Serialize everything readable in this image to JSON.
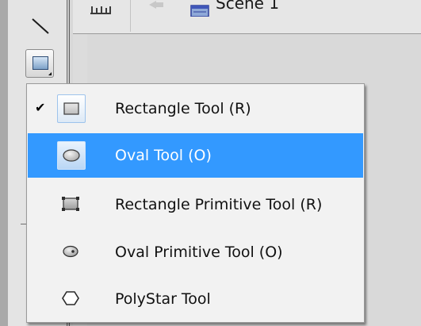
{
  "editbar": {
    "scene_label": "Scene 1"
  },
  "toolbar": {
    "tools": [
      {
        "name": "line-tool",
        "icon": "line-icon"
      },
      {
        "name": "rectangle-tool",
        "icon": "rectangle-icon",
        "active": true
      }
    ]
  },
  "menu": {
    "items": [
      {
        "label": "Rectangle Tool (R)",
        "icon": "rectangle-icon",
        "checked": true,
        "highlighted": false
      },
      {
        "label": "Oval Tool (O)",
        "icon": "oval-icon",
        "checked": false,
        "highlighted": true
      },
      {
        "label": "Rectangle Primitive Tool (R)",
        "icon": "rectangle-primitive-icon",
        "checked": false,
        "highlighted": false
      },
      {
        "label": "Oval Primitive Tool (O)",
        "icon": "oval-primitive-icon",
        "checked": false,
        "highlighted": false
      },
      {
        "label": "PolyStar Tool",
        "icon": "polystar-icon",
        "checked": false,
        "highlighted": false
      }
    ],
    "check_glyph": "✔"
  },
  "colors": {
    "highlight": "#3399ff",
    "menu_bg": "#f2f2f2",
    "panel_bg": "#e4e4e4"
  }
}
